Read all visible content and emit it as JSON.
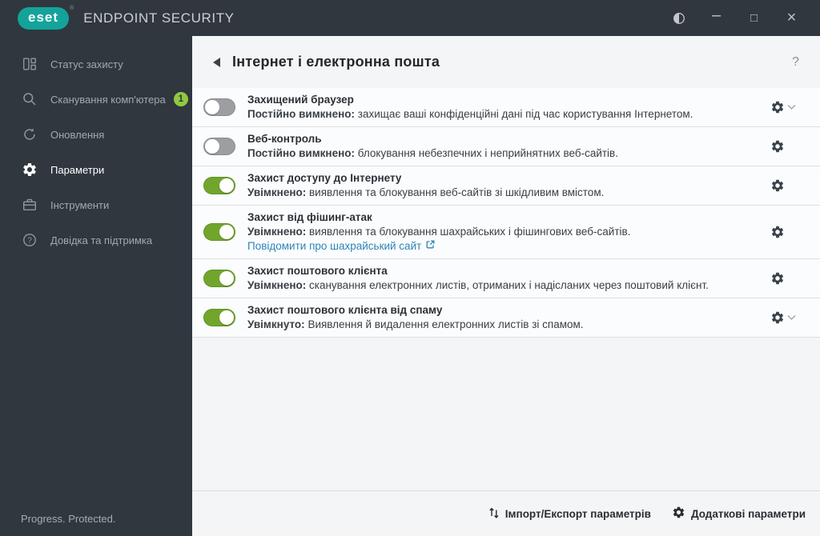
{
  "window": {
    "brand": "eset",
    "registered_mark": "®",
    "title": "ENDPOINT SECURITY",
    "controls": {
      "minimize": "–",
      "maximize": "□",
      "close": "×"
    }
  },
  "sidebar": {
    "items": [
      {
        "label": "Статус захисту",
        "icon": "protection-status-icon"
      },
      {
        "label": "Сканування комп'ютера",
        "icon": "computer-scan-icon",
        "badge": "1"
      },
      {
        "label": "Оновлення",
        "icon": "update-icon"
      },
      {
        "label": "Параметри",
        "icon": "settings-icon",
        "selected": true
      },
      {
        "label": "Інструменти",
        "icon": "tools-icon"
      },
      {
        "label": "Довідка та підтримка",
        "icon": "help-icon"
      }
    ],
    "footer": "Progress. Protected."
  },
  "main": {
    "title": "Інтернет і електронна пошта",
    "help": "?",
    "rows": [
      {
        "title": "Захищений браузер",
        "enabled": false,
        "status": "Постійно вимкнено:",
        "desc": " захищає ваші конфіденційні дані під час користування Інтернетом.",
        "has_menu": true
      },
      {
        "title": "Веб-контроль",
        "enabled": false,
        "status": "Постійно вимкнено:",
        "desc": " блокування небезпечних і неприйнятних веб-сайтів.",
        "has_menu": false
      },
      {
        "title": "Захист доступу до Інтернету",
        "enabled": true,
        "status": "Увімкнено:",
        "desc": " виявлення та блокування веб-сайтів зі шкідливим вмістом.",
        "has_menu": false
      },
      {
        "title": "Захист від фішинг-атак",
        "enabled": true,
        "status": "Увімкнено:",
        "desc": " виявлення та блокування шахрайських і фішингових веб-сайтів.",
        "link": "Повідомити про шахрайський сайт",
        "has_menu": false
      },
      {
        "title": "Захист поштового клієнта",
        "enabled": true,
        "status": "Увімкнено:",
        "desc": " сканування електронних листів, отриманих і надісланих через поштовий клієнт.",
        "has_menu": false
      },
      {
        "title": "Захист поштового клієнта від спаму",
        "enabled": true,
        "status": "Увімкнуто:",
        "desc": " Виявлення й видалення електронних листів зі спамом.",
        "has_menu": true
      }
    ],
    "footer": {
      "import_export": "Імпорт/Експорт параметрів",
      "advanced": "Додаткові параметри"
    }
  },
  "colors": {
    "topbar_bg": "#30373f",
    "brand_teal": "#13a39a",
    "toggle_on_green": "#71a52c",
    "badge_green": "#93c840",
    "link_blue": "#2f84b5",
    "panel_bg": "#f4f5f6"
  }
}
